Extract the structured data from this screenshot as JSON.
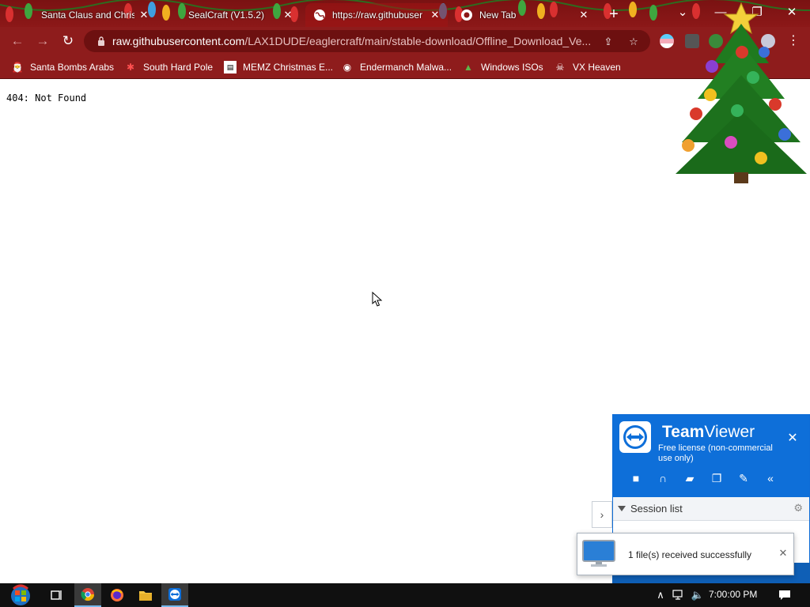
{
  "browser": {
    "tabs": [
      {
        "title": "Santa Claus and Christ",
        "active": false
      },
      {
        "title": "SealCraft (V1.5.2)",
        "active": false
      },
      {
        "title": "https://raw.githubuser",
        "active": true
      },
      {
        "title": "New Tab",
        "active": false
      }
    ],
    "new_tab_label": "+",
    "window_controls": {
      "tab_search": "⌄",
      "minimize": "—",
      "maximize": "❐",
      "close": "✕"
    },
    "omnibox": {
      "host": "raw.githubusercontent.com",
      "path": "/LAX1DUDE/eaglercraft/main/stable-download/Offline_Download_Ve..."
    },
    "bookmarks": [
      {
        "label": "Santa Bombs Arabs",
        "icon": "santa-icon"
      },
      {
        "label": "South Hard Pole",
        "icon": "snowflake-icon"
      },
      {
        "label": "MEMZ Christmas E...",
        "icon": "page-icon"
      },
      {
        "label": "Endermanch Malwa...",
        "icon": "raccoon-icon"
      },
      {
        "label": "Windows ISOs",
        "icon": "tree-icon"
      },
      {
        "label": "VX Heaven",
        "icon": "skull-icon"
      }
    ],
    "theme_colors": {
      "frame": "#8e1c1c",
      "omnibox": "#6d1010"
    }
  },
  "page": {
    "body_text": "404: Not Found"
  },
  "teamviewer": {
    "brand_bold": "Team",
    "brand_light": "Viewer",
    "license": "Free license (non-commercial use only)",
    "close": "✕",
    "tools": [
      {
        "name": "video-icon",
        "glyph": "■"
      },
      {
        "name": "headset-icon",
        "glyph": "∩"
      },
      {
        "name": "chat-icon",
        "glyph": "▰"
      },
      {
        "name": "files-icon",
        "glyph": "❐"
      },
      {
        "name": "brush-icon",
        "glyph": "✎"
      },
      {
        "name": "collapse-icon",
        "glyph": "«"
      }
    ],
    "session_list_label": "Session list",
    "expand_arrow": "›",
    "toast_message": "1 file(s) received successfully",
    "toast_close": "✕",
    "brand_color": "#0e6fd9"
  },
  "taskbar": {
    "clock": "7:00:00 PM",
    "tray_up": "∧",
    "volume": "🔈"
  }
}
